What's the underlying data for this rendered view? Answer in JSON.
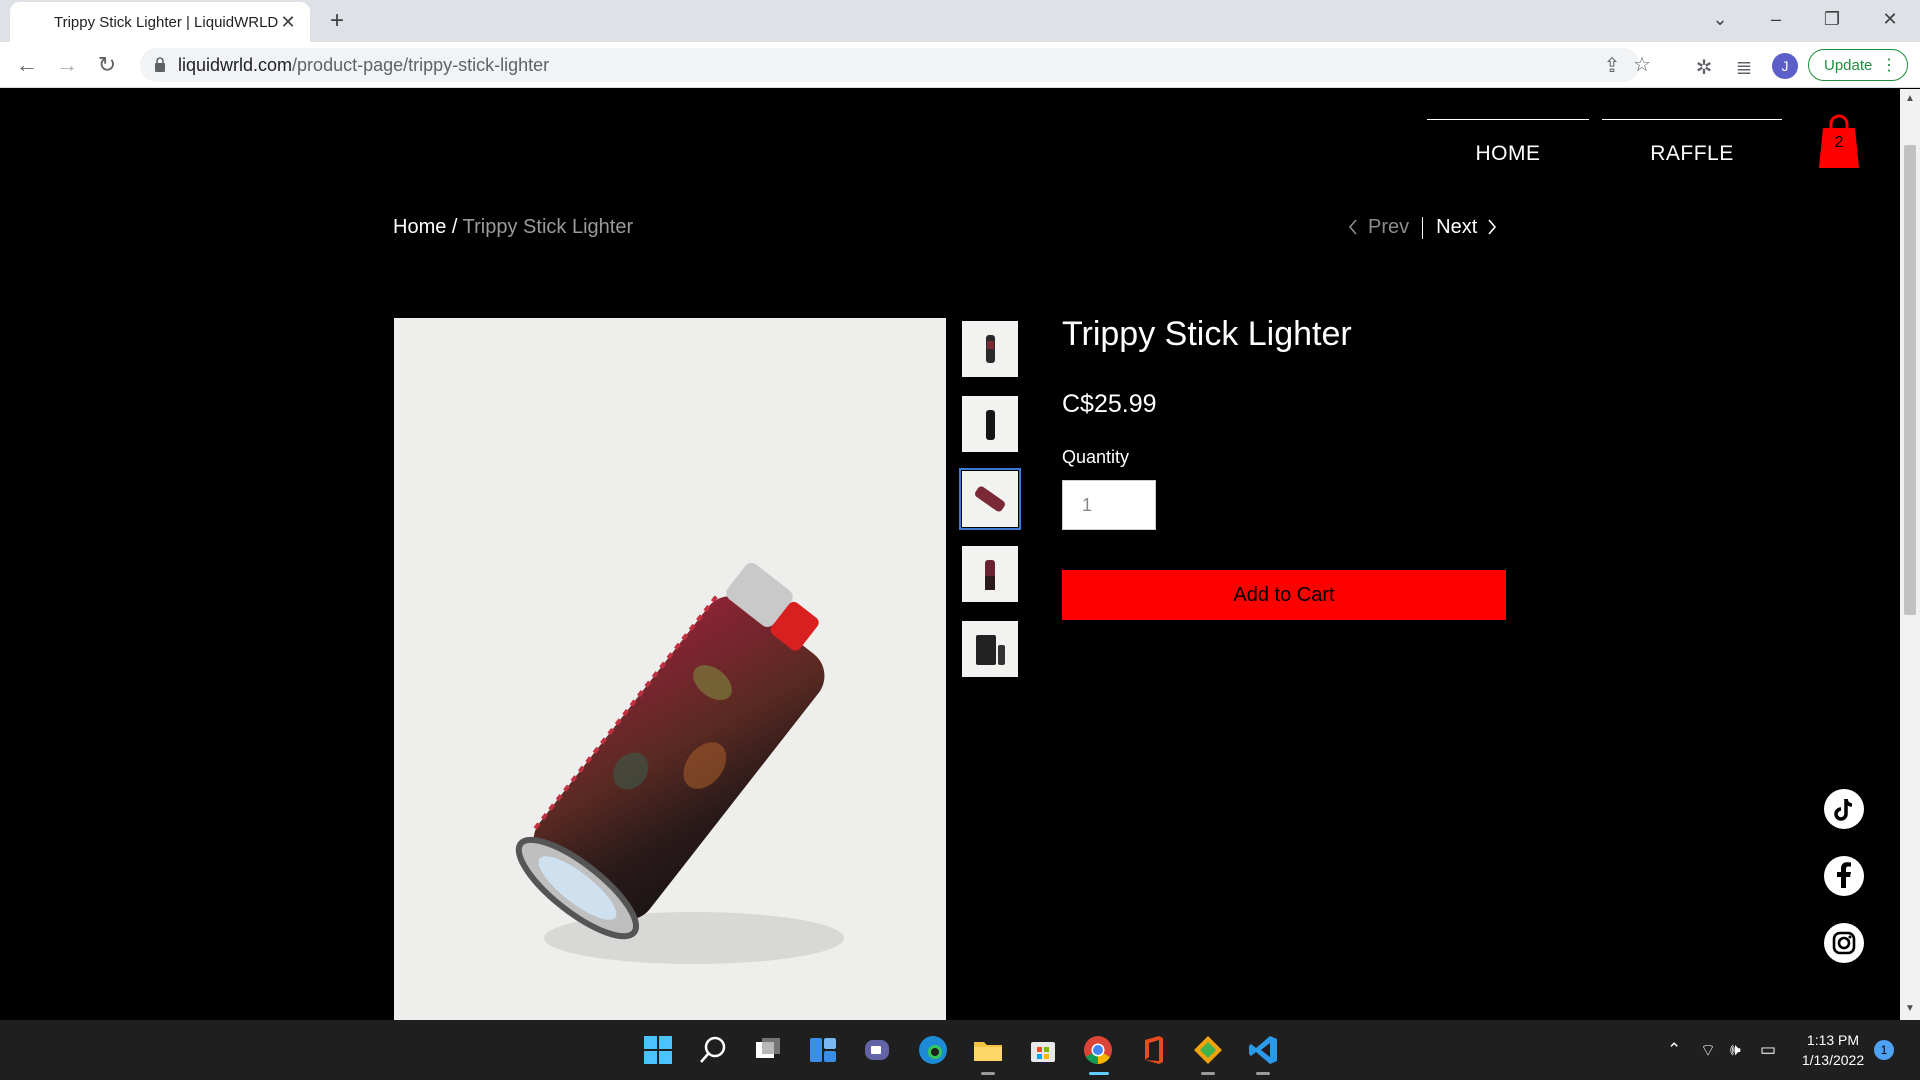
{
  "browser": {
    "tab_title": "Trippy Stick Lighter | LiquidWRLD",
    "url_host": "liquidwrld.com",
    "url_path": "/product-page/trippy-stick-lighter",
    "avatar_letter": "J",
    "update_label": "Update"
  },
  "site": {
    "nav": [
      {
        "label": "HOME"
      },
      {
        "label": "RAFFLE"
      }
    ],
    "cart_count": "2",
    "accent_color": "#ff0000"
  },
  "breadcrumb": {
    "home": "Home",
    "separator": " / ",
    "current": "Trippy Stick Lighter"
  },
  "pager": {
    "prev": "Prev",
    "next": "Next"
  },
  "product": {
    "title": "Trippy Stick Lighter",
    "price": "C$25.99",
    "quantity_label": "Quantity",
    "quantity_value": "1",
    "add_to_cart": "Add to Cart",
    "selected_thumbnail": 3,
    "thumbnails": [
      "thumbnail-1",
      "thumbnail-2",
      "thumbnail-3",
      "thumbnail-4",
      "thumbnail-5"
    ]
  },
  "social": [
    "tiktok-icon",
    "facebook-icon",
    "instagram-icon"
  ],
  "taskbar": {
    "time": "1:13 PM",
    "date": "1/13/2022",
    "notifications": "1"
  }
}
